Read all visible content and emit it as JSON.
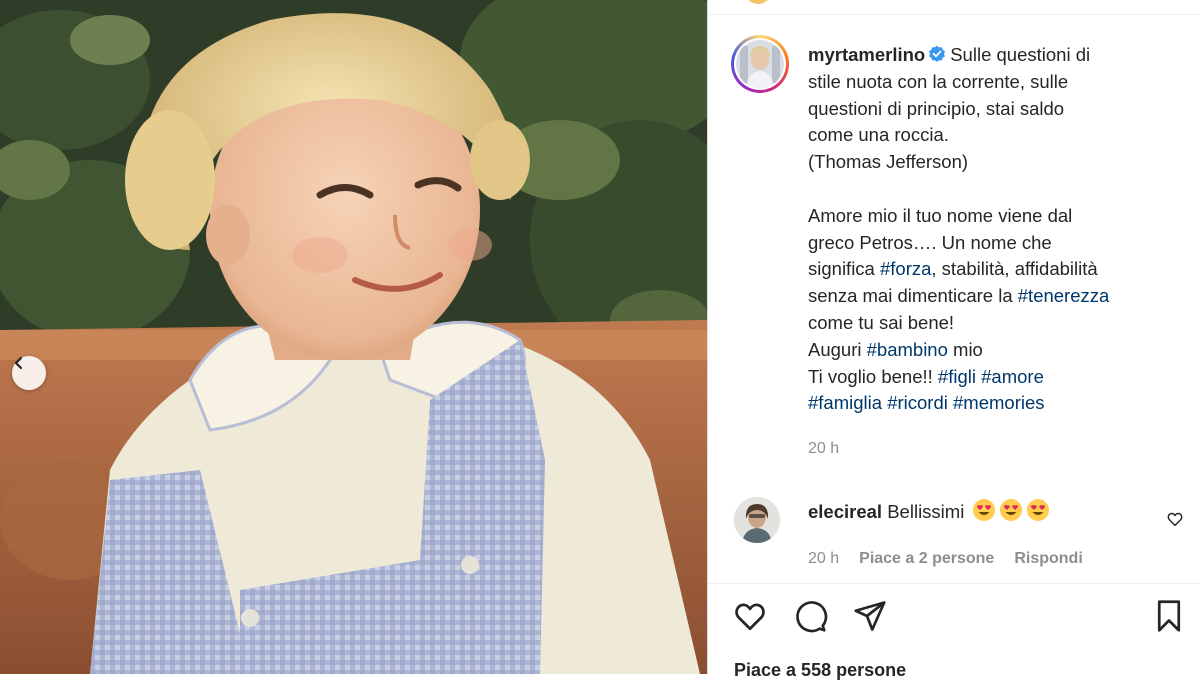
{
  "photo": {
    "description_icon": "chevron-left-icon"
  },
  "post": {
    "username": "myrtamerlino",
    "verified_icon": "verified-badge-icon",
    "caption_lines": [
      [
        {
          "t": "Sulle questioni di",
          "tag": false
        }
      ],
      [
        {
          "t": "stile nuota con la corrente, sulle",
          "tag": false
        }
      ],
      [
        {
          "t": "questioni di principio, stai saldo",
          "tag": false
        }
      ],
      [
        {
          "t": "come una roccia.",
          "tag": false
        }
      ],
      [
        {
          "t": "(Thomas Jefferson)",
          "tag": false
        }
      ],
      [],
      [
        {
          "t": "Amore mio il tuo nome viene dal",
          "tag": false
        }
      ],
      [
        {
          "t": "greco Petros…. Un nome che",
          "tag": false
        }
      ],
      [
        {
          "t": "significa ",
          "tag": false
        },
        {
          "t": "#forza",
          "tag": true
        },
        {
          "t": ", stabilità, affidabilità",
          "tag": false
        }
      ],
      [
        {
          "t": "senza mai dimenticare la ",
          "tag": false
        },
        {
          "t": "#tenerezza",
          "tag": true
        }
      ],
      [
        {
          "t": "come tu sai bene!",
          "tag": false
        }
      ],
      [
        {
          "t": "Auguri ",
          "tag": false
        },
        {
          "t": "#bambino",
          "tag": true
        },
        {
          "t": " mio",
          "tag": false
        }
      ],
      [
        {
          "t": "Ti voglio bene!! ",
          "tag": false
        },
        {
          "t": "#figli",
          "tag": true
        },
        {
          "t": " ",
          "tag": false
        },
        {
          "t": "#amore",
          "tag": true
        }
      ],
      [
        {
          "t": "#famiglia",
          "tag": true
        },
        {
          "t": " ",
          "tag": false
        },
        {
          "t": "#ricordi",
          "tag": true
        },
        {
          "t": " ",
          "tag": false
        },
        {
          "t": "#memories",
          "tag": true
        }
      ]
    ],
    "time": "20 h"
  },
  "comment": {
    "username": "elecireal",
    "text": "Bellissimi",
    "emoji_count": 3,
    "emoji_icon": "heart-eyes-emoji-icon",
    "time": "20 h",
    "likes": "Piace a 2 persone",
    "reply": "Rispondi"
  },
  "actions": {
    "like_icon": "heart-icon",
    "comment_icon": "comment-icon",
    "share_icon": "paper-plane-icon",
    "save_icon": "bookmark-icon"
  },
  "likes_text": "Piace a 558 persone",
  "colors": {
    "hashtag": "#00376b",
    "secondary_text": "#8e8e8e",
    "verified": "#3897f0"
  }
}
